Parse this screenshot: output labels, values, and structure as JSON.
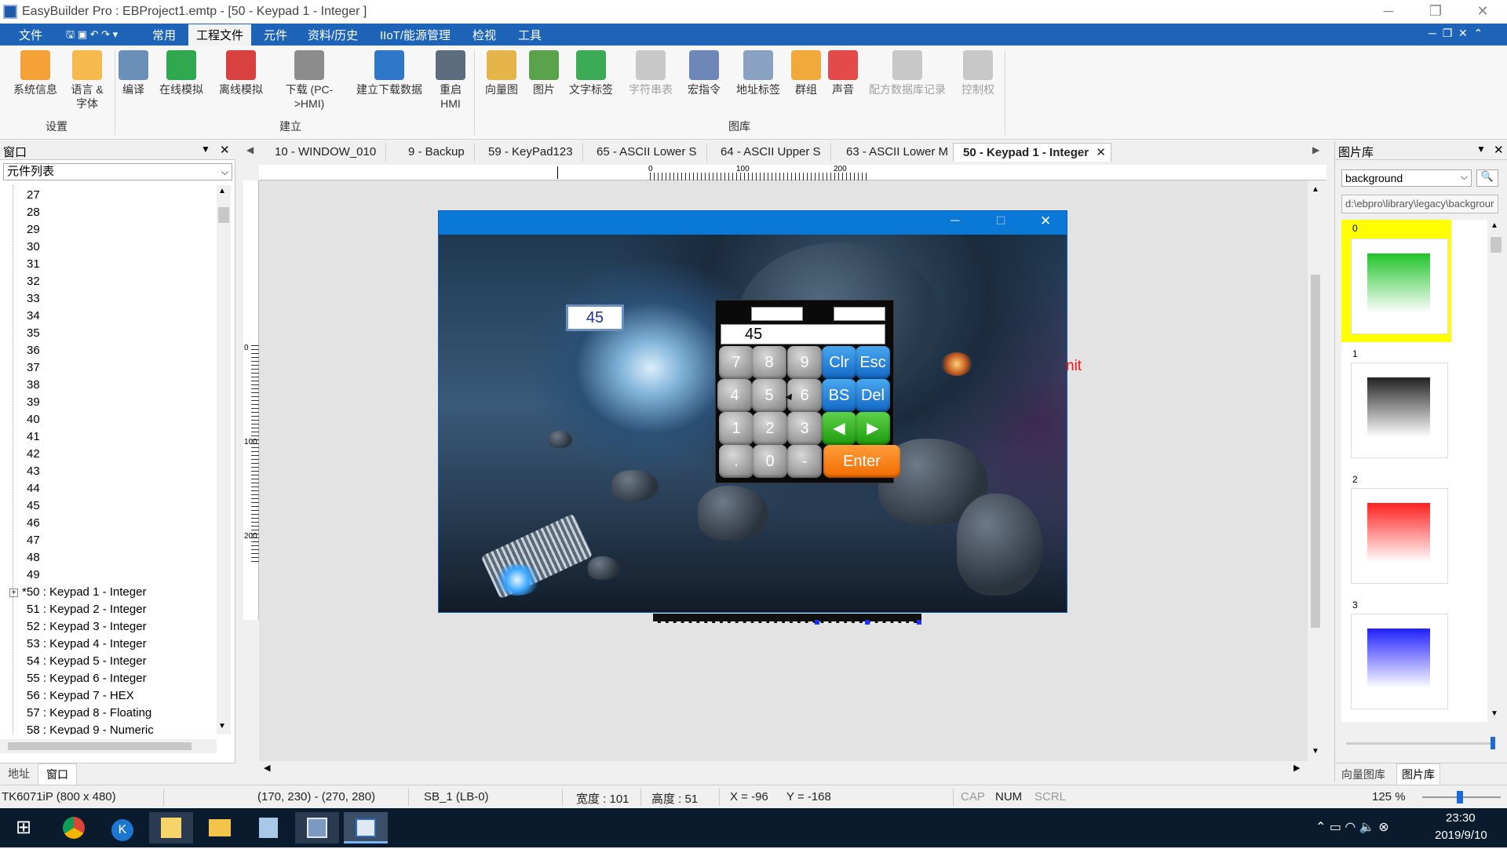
{
  "window": {
    "title": "EasyBuilder Pro : EBProject1.emtp - [50 - Keypad 1 - Integer ]"
  },
  "menu": [
    "文件",
    "常用",
    "工程文件",
    "元件",
    "资料/历史",
    "IIoT/能源管理",
    "检视",
    "工具"
  ],
  "menu_active": "工程文件",
  "ribbon": {
    "settings": [
      "系统信息",
      "语言 &\n字体"
    ],
    "settings_group": "设置",
    "build": [
      "编译",
      "在线模拟",
      "离线模拟",
      "下载 (PC-\n>HMI)",
      "建立下载数据",
      "重启\nHMI"
    ],
    "build_group": "建立",
    "library": [
      "向量图",
      "图片",
      "文字标签",
      "字符串表",
      "宏指令",
      "地址标签",
      "群组",
      "声音",
      "配方数据库记录",
      "控制权"
    ],
    "library_group": "图库"
  },
  "left_panel": {
    "header": "窗口",
    "combo": "元件列表",
    "tree": [
      "27",
      "28",
      "29",
      "30",
      "31",
      "32",
      "33",
      "34",
      "35",
      "36",
      "37",
      "38",
      "39",
      "40",
      "41",
      "42",
      "43",
      "44",
      "45",
      "46",
      "47",
      "48",
      "49",
      "*50 : Keypad 1 - Integer",
      "51 : Keypad 2 - Integer",
      "52 : Keypad 3 - Integer",
      "53 : Keypad 4 - Integer",
      "54 : Keypad 5 - Integer",
      "55 : Keypad 6 - Integer",
      "56 : Keypad 7 - HEX",
      "57 : Keypad 8 - Floating",
      "58 : Keypad 9 - Numeric"
    ],
    "tabs": [
      "地址",
      "窗口"
    ]
  },
  "tabs": [
    "10 - WINDOW_010",
    "9 - Backup",
    "59 - KeyPad123",
    "65 - ASCII Lower S",
    "64 - ASCII Upper S",
    "63 - ASCII Lower M",
    "50 - Keypad 1 - Integer"
  ],
  "ruler": {
    "h": [
      "0",
      "100",
      "200"
    ],
    "v": [
      "0",
      "100",
      "200"
    ]
  },
  "hmi": {
    "value_box": "45",
    "keypad_display": "45",
    "keys_row1": [
      "7",
      "8",
      "9",
      "Clr",
      "Esc"
    ],
    "keys_row2": [
      "4",
      "5",
      "6",
      "BS",
      "Del"
    ],
    "keys_row3": [
      "1",
      "2",
      "3"
    ],
    "keys_row4": [
      ".",
      "0",
      "-",
      "Enter"
    ],
    "partial_text": "nit"
  },
  "right_panel": {
    "header": "图片库",
    "combo": "background",
    "path": "d:\\ebpro\\library\\legacy\\backgrour",
    "items": [
      {
        "label": "0",
        "color": "#22c42a"
      },
      {
        "label": "1",
        "color": "#222222"
      },
      {
        "label": "2",
        "color": "#ff2020"
      },
      {
        "label": "3",
        "color": "#2020ff"
      }
    ],
    "tabs": [
      "向量图库",
      "图片库"
    ]
  },
  "status": {
    "model": "TK6071iP (800 x 480)",
    "coords": "(170, 230) - (270, 280)",
    "object": "SB_1 (LB-0)",
    "width": "宽度 : 101",
    "height": "高度 : 51",
    "x": "X = -96",
    "y": "Y = -168",
    "cap": "CAP",
    "num": "NUM",
    "scrl": "SCRL",
    "zoom": "125 %"
  },
  "taskbar": {
    "time": "23:30",
    "date": "2019/9/10"
  }
}
